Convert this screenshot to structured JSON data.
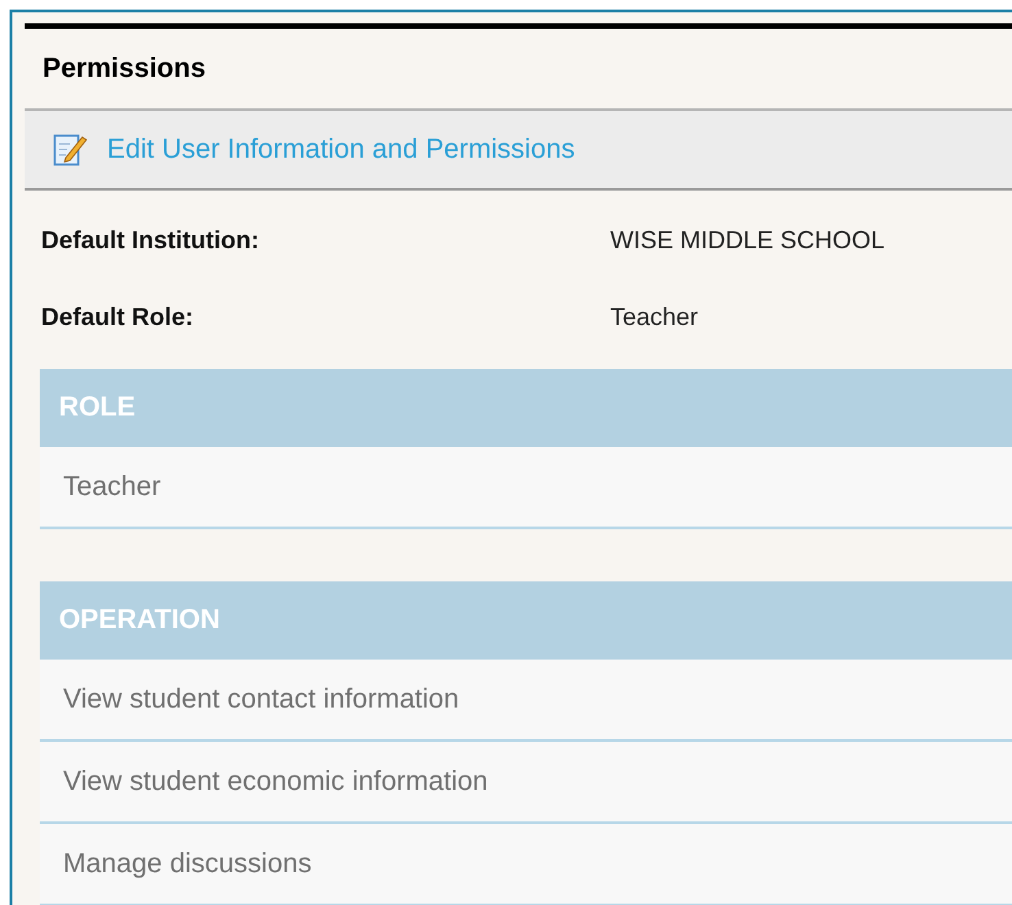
{
  "panel": {
    "title": "Permissions"
  },
  "edit_link": {
    "label": "Edit User Information and Permissions"
  },
  "details": [
    {
      "label": "Default Institution:",
      "value": "WISE MIDDLE SCHOOL"
    },
    {
      "label": "Default Role:",
      "value": "Teacher"
    }
  ],
  "tables": [
    {
      "heading": "ROLE",
      "rows": [
        "Teacher"
      ]
    },
    {
      "heading": "OPERATION",
      "rows": [
        "View student contact information",
        "View student economic information",
        "Manage discussions"
      ]
    }
  ]
}
